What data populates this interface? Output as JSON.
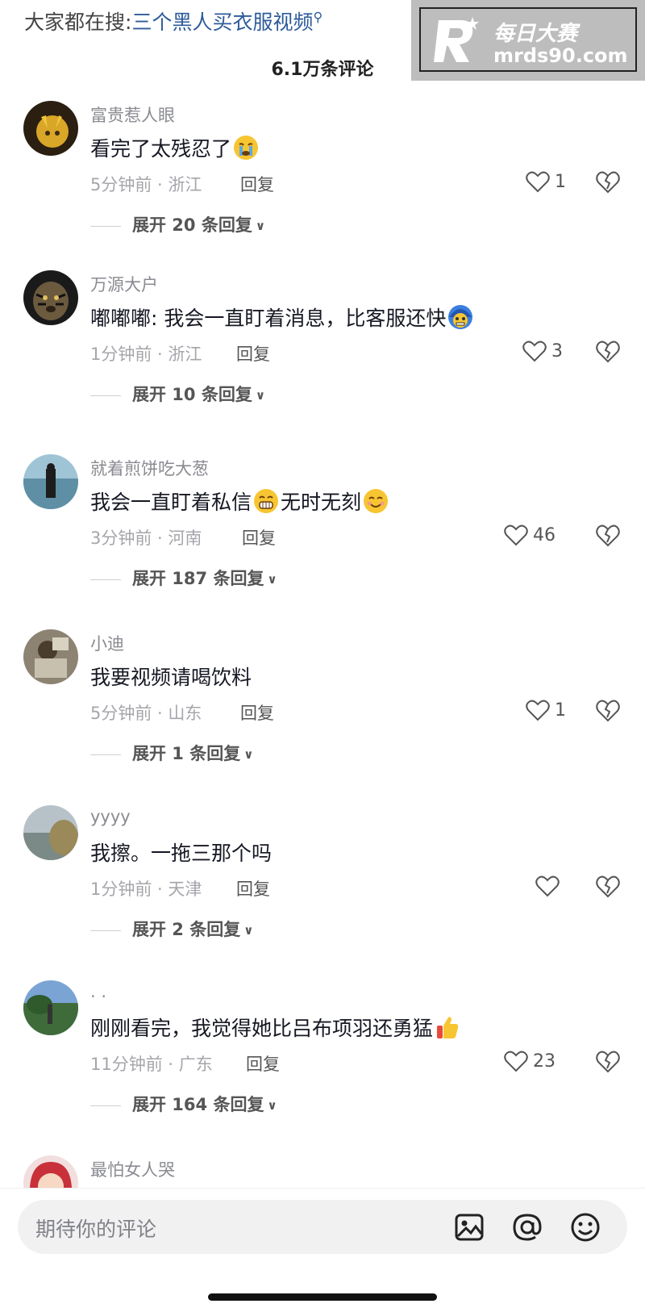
{
  "search_hint": {
    "label": "大家都在搜:",
    "query": "三个黑人买衣服视频"
  },
  "watermark": {
    "line1": "每日大赛",
    "line2": "mrds90.com"
  },
  "comment_count": "6.1万条评论",
  "reply_label": "回复",
  "comments": [
    {
      "user": "富贵惹人眼",
      "text": [
        "看完了太残忍了"
      ],
      "emoji": [
        "crying-emoji"
      ],
      "time_location": "5分钟前 · 浙江",
      "likes": "1",
      "expand": "展开 20 条回复"
    },
    {
      "user": "万源大户",
      "text": [
        "嘟嘟嘟: 我会一直盯着消息，比客服还快"
      ],
      "emoji": [
        "freezing-emoji"
      ],
      "time_location": "1分钟前 · 浙江",
      "likes": "3",
      "expand": "展开 10 条回复"
    },
    {
      "user": "就着煎饼吃大葱",
      "text": [
        "我会一直盯着私信",
        "无时无刻"
      ],
      "emoji": [
        "grin-emoji",
        "smile-emoji"
      ],
      "time_location": "3分钟前 · 河南",
      "likes": "46",
      "expand": "展开 187 条回复"
    },
    {
      "user": "小迪",
      "text": [
        "我要视频请喝饮料"
      ],
      "emoji": [],
      "time_location": "5分钟前 · 山东",
      "likes": "1",
      "expand": "展开 1 条回复"
    },
    {
      "user": "yyyy",
      "text": [
        "我擦。一拖三那个吗"
      ],
      "emoji": [],
      "time_location": "1分钟前 · 天津",
      "likes": "",
      "expand": "展开 2 条回复"
    },
    {
      "user": ".   .",
      "text": [
        "刚刚看完，我觉得她比吕布项羽还勇猛"
      ],
      "emoji": [
        "thumbs-up-emoji"
      ],
      "time_location": "11分钟前 · 广东",
      "likes": "23",
      "expand": "展开 164 条回复"
    },
    {
      "user": "最怕女人哭"
    }
  ],
  "input_placeholder": "期待你的评论",
  "icons": [
    "image-icon",
    "at-icon",
    "emoji-icon",
    "heart-icon",
    "dislike-icon"
  ]
}
